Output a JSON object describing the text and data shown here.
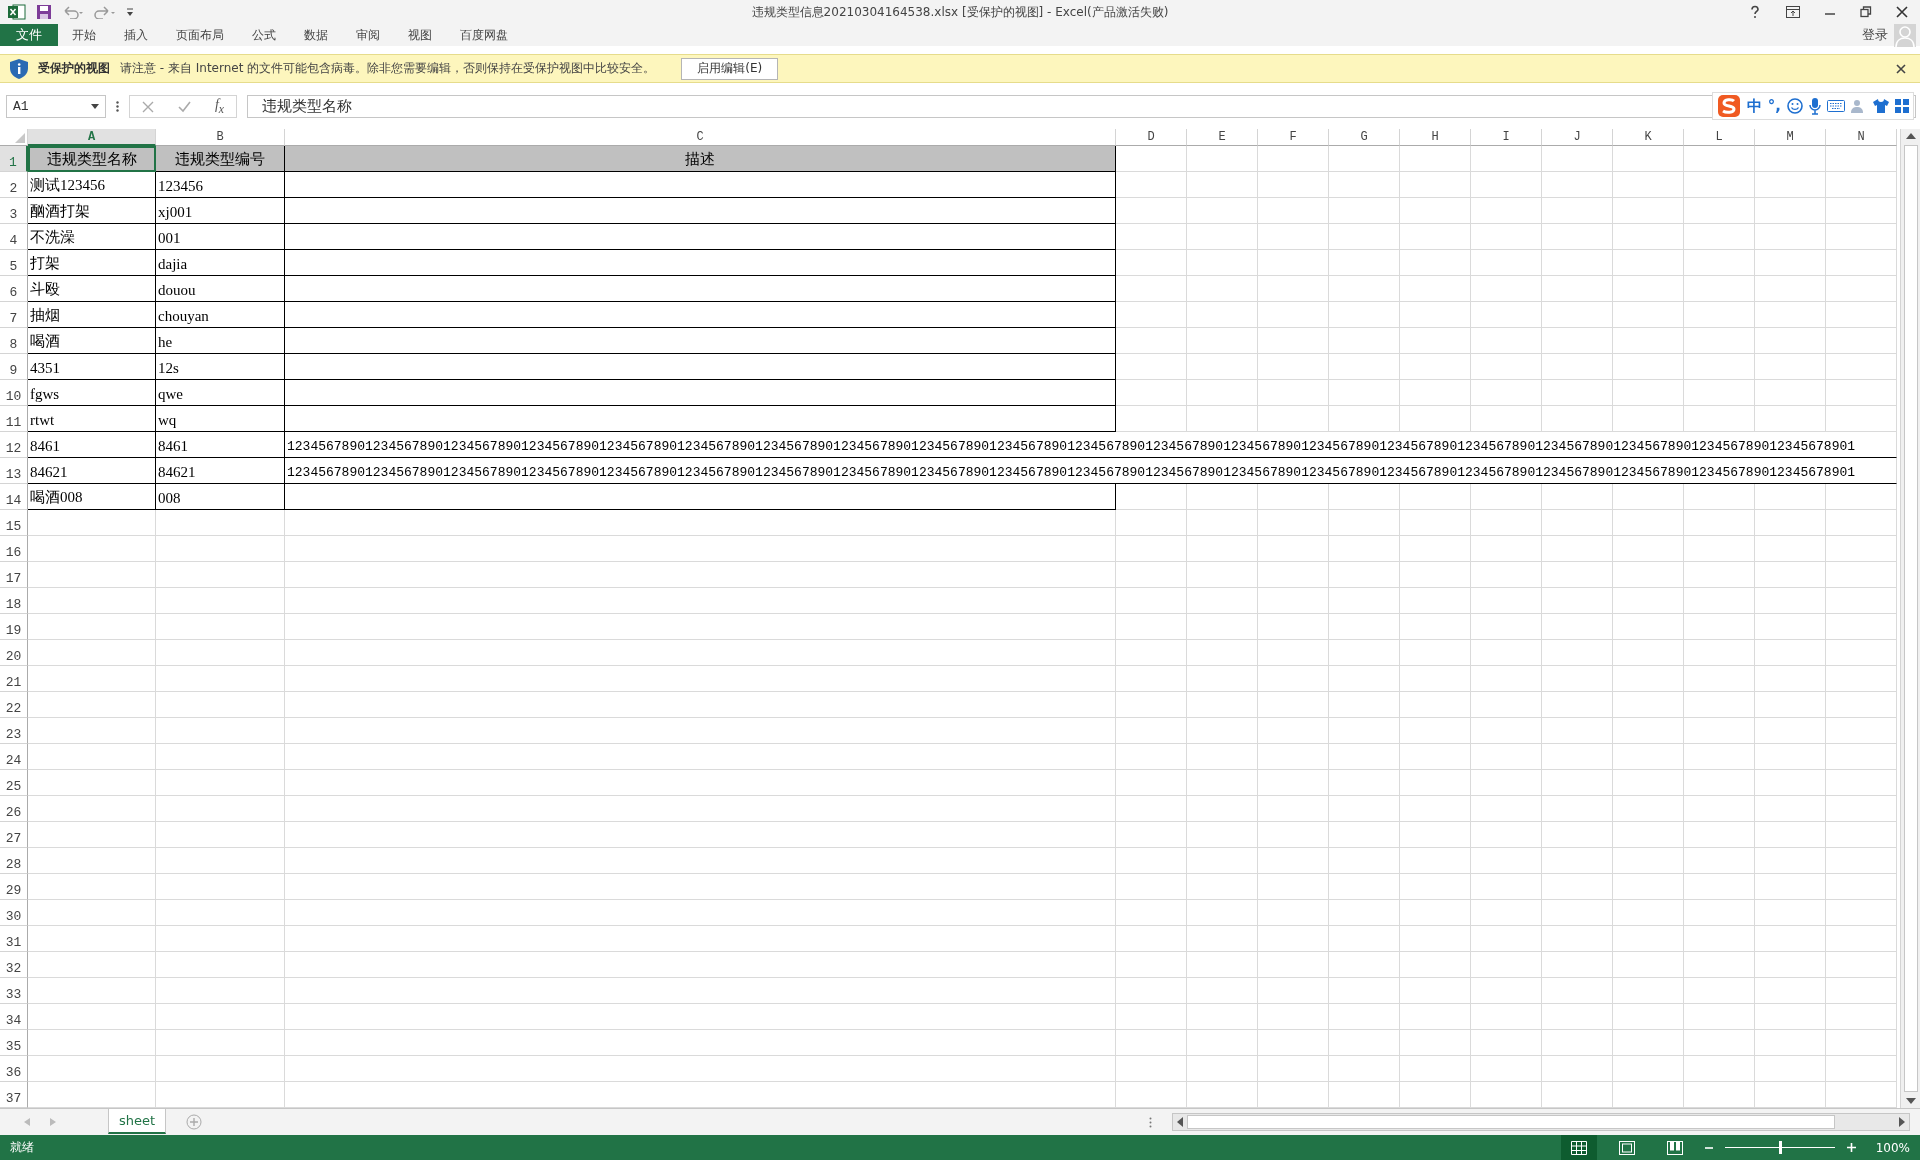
{
  "window": {
    "title": "违规类型信息20210304164538.xlsx  [受保护的视图] - Excel(产品激活失败)",
    "sign_in": "登录"
  },
  "file_tab": "文件",
  "ribbon_tabs": [
    {
      "label": "开始",
      "selected": false
    },
    {
      "label": "插入",
      "selected": false
    },
    {
      "label": "页面布局",
      "selected": false
    },
    {
      "label": "公式",
      "selected": false
    },
    {
      "label": "数据",
      "selected": false
    },
    {
      "label": "审阅",
      "selected": false
    },
    {
      "label": "视图",
      "selected": false
    },
    {
      "label": "百度网盘",
      "selected": false
    }
  ],
  "protected_bar": {
    "title": "受保护的视图",
    "message": "请注意 - 来自 Internet 的文件可能包含病毒。除非您需要编辑，否则保持在受保护视图中比较安全。",
    "button": "启用编辑(E)"
  },
  "formula_bar": {
    "name_box": "A1",
    "fx": "f$_{x}$",
    "value": "违规类型名称"
  },
  "ime_toolbar": {
    "mode": "中",
    "punctuation": "°,"
  },
  "columns": [
    {
      "label": "A",
      "selected": true
    },
    {
      "label": "B",
      "selected": false
    },
    {
      "label": "C",
      "selected": false
    },
    {
      "label": "D",
      "selected": false
    },
    {
      "label": "E",
      "selected": false
    },
    {
      "label": "F",
      "selected": false
    },
    {
      "label": "G",
      "selected": false
    },
    {
      "label": "H",
      "selected": false
    },
    {
      "label": "I",
      "selected": false
    },
    {
      "label": "J",
      "selected": false
    },
    {
      "label": "K",
      "selected": false
    },
    {
      "label": "L",
      "selected": false
    },
    {
      "label": "M",
      "selected": false
    },
    {
      "label": "N",
      "selected": false
    }
  ],
  "row_numbers": [
    {
      "label": "1",
      "selected": true
    },
    {
      "label": "2",
      "selected": false
    },
    {
      "label": "3",
      "selected": false
    },
    {
      "label": "4",
      "selected": false
    },
    {
      "label": "5",
      "selected": false
    },
    {
      "label": "6",
      "selected": false
    },
    {
      "label": "7",
      "selected": false
    },
    {
      "label": "8",
      "selected": false
    },
    {
      "label": "9",
      "selected": false
    },
    {
      "label": "10",
      "selected": false
    },
    {
      "label": "11",
      "selected": false
    },
    {
      "label": "12",
      "selected": false
    },
    {
      "label": "13",
      "selected": false
    },
    {
      "label": "14",
      "selected": false
    },
    {
      "label": "15",
      "selected": false
    },
    {
      "label": "16",
      "selected": false
    },
    {
      "label": "17",
      "selected": false
    },
    {
      "label": "18",
      "selected": false
    },
    {
      "label": "19",
      "selected": false
    },
    {
      "label": "20",
      "selected": false
    },
    {
      "label": "21",
      "selected": false
    },
    {
      "label": "22",
      "selected": false
    },
    {
      "label": "23",
      "selected": false
    },
    {
      "label": "24",
      "selected": false
    },
    {
      "label": "25",
      "selected": false
    },
    {
      "label": "26",
      "selected": false
    },
    {
      "label": "27",
      "selected": false
    },
    {
      "label": "28",
      "selected": false
    },
    {
      "label": "29",
      "selected": false
    },
    {
      "label": "30",
      "selected": false
    },
    {
      "label": "31",
      "selected": false
    },
    {
      "label": "32",
      "selected": false
    },
    {
      "label": "33",
      "selected": false
    },
    {
      "label": "34",
      "selected": false
    },
    {
      "label": "35",
      "selected": false
    },
    {
      "label": "36",
      "selected": false
    },
    {
      "label": "37",
      "selected": false
    }
  ],
  "table": {
    "header": [
      "违规类型名称",
      "违规类型编号",
      "描述"
    ],
    "rows": [
      {
        "name": "测试123456",
        "code": "123456"
      },
      {
        "name": "酗酒打架",
        "code": "xj001"
      },
      {
        "name": "不洗澡",
        "code": "001"
      },
      {
        "name": "打架",
        "code": "dajia"
      },
      {
        "name": "斗殴",
        "code": "douou"
      },
      {
        "name": "抽烟",
        "code": "chouyan"
      },
      {
        "name": "喝酒",
        "code": "he"
      },
      {
        "name": "4351",
        "code": "12s"
      },
      {
        "name": "fgws",
        "code": "qwe"
      },
      {
        "name": "rtwt",
        "code": "wq"
      },
      {
        "name": "8461",
        "code": "8461",
        "description": "123456789012345678901234567890123456789012345678901234567890123456789012345678901234567890123456789012345678901234567890123456789012345678901234567890123456789012345678901234567890123456789012345678901"
      },
      {
        "name": "84621",
        "code": "84621",
        "description": "123456789012345678901234567890123456789012345678901234567890123456789012345678901234567890123456789012345678901234567890123456789012345678901234567890123456789012345678901234567890123456789012345678901"
      },
      {
        "name": "喝酒008",
        "code": "008"
      }
    ]
  },
  "sheet_tabs": [
    {
      "label": "sheet",
      "selected": true
    }
  ],
  "status_bar": {
    "text": "就绪",
    "views": [
      {
        "kind": "normal",
        "selected": true
      },
      {
        "kind": "page-layout",
        "selected": false
      },
      {
        "kind": "page-break",
        "selected": false
      }
    ],
    "zoom": {
      "level": 0.5,
      "reading": "100%"
    }
  }
}
